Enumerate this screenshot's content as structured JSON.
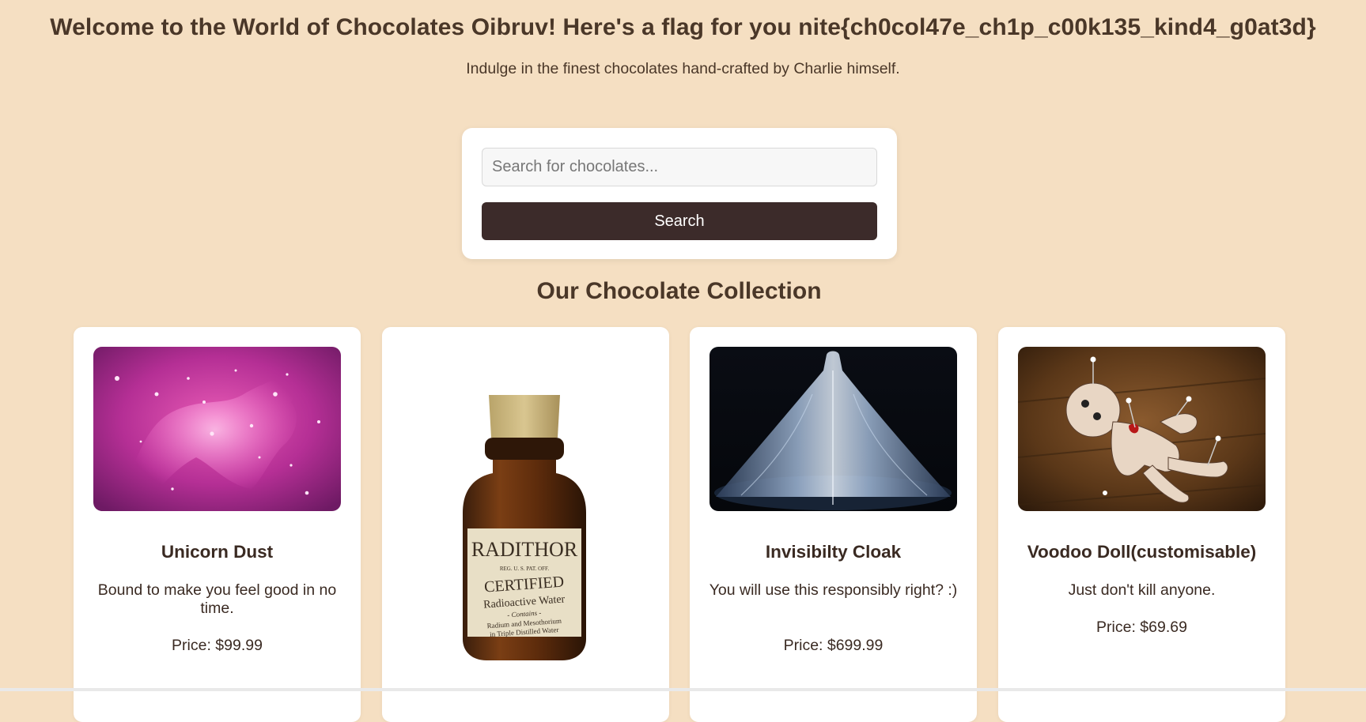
{
  "header": {
    "title": "Welcome to the World of Chocolates Oibruv! Here's a flag for you nite{ch0col47e_ch1p_c00k135_kind4_g0at3d}",
    "subtitle": "Indulge in the finest chocolates hand-crafted by Charlie himself."
  },
  "search": {
    "placeholder": "Search for chocolates...",
    "value": "",
    "button_label": "Search"
  },
  "collection": {
    "title": "Our Chocolate Collection",
    "products": [
      {
        "name": "Unicorn Dust",
        "description": "Bound to make you feel good in no time.",
        "price": "Price: $99.99",
        "image": "unicorn-image"
      },
      {
        "name": "",
        "description": "",
        "price": "",
        "image": "radithor-bottle-image",
        "label_text": "RADITHOR REG. U. S. PAT. OFF. CERTIFIED Radioactive Water Contains Radium and Mesothorium in Triple Distilled Water"
      },
      {
        "name": "Invisibilty Cloak",
        "description": "You will use this responsibly right? :)",
        "price": "Price: $699.99",
        "image": "cloak-image"
      },
      {
        "name": "Voodoo Doll(customisable)",
        "description": "Just don't kill anyone.",
        "price": "Price: $69.69",
        "image": "voodoo-doll-image"
      }
    ]
  },
  "colors": {
    "background": "#f5dfc2",
    "text": "#4a3728",
    "button": "#3c2b2a",
    "card": "#ffffff"
  }
}
